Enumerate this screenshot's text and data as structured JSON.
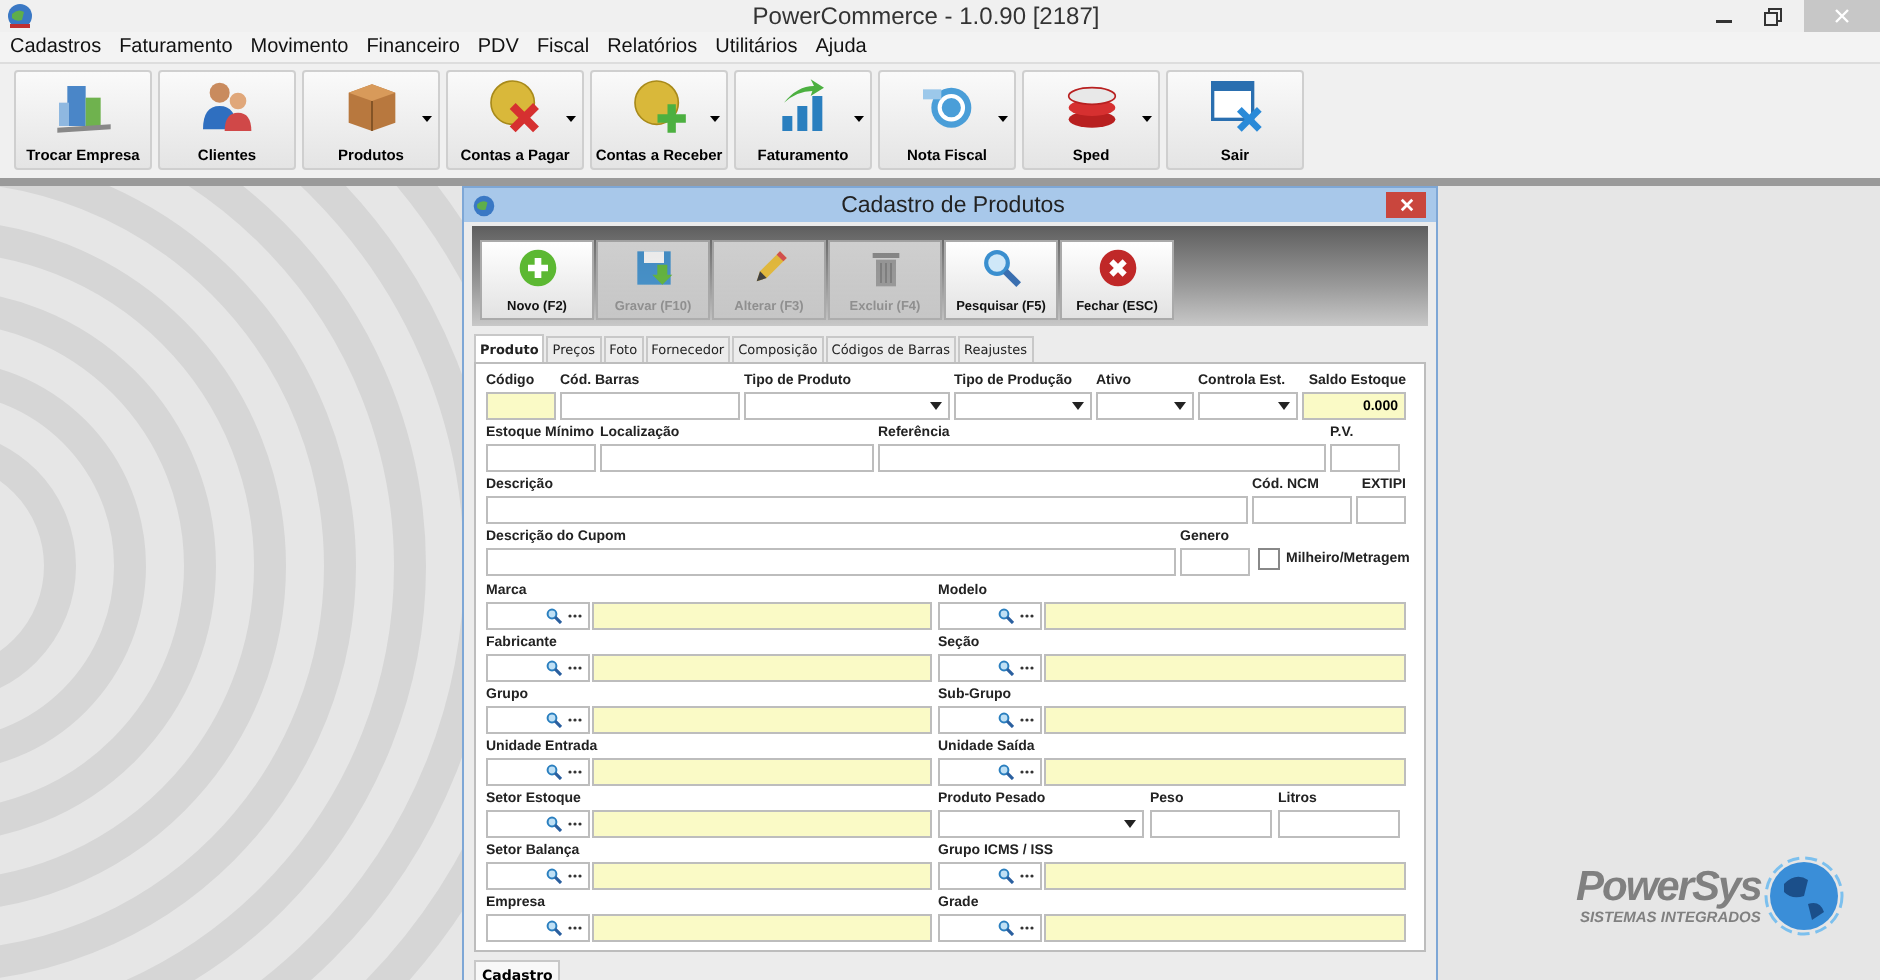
{
  "window": {
    "title": "PowerCommerce - 1.0.90 [2187]"
  },
  "menu": [
    "Cadastros",
    "Faturamento",
    "Movimento",
    "Financeiro",
    "PDV",
    "Fiscal",
    "Relatórios",
    "Utilitários",
    "Ajuda"
  ],
  "toolbar": [
    {
      "label": "Trocar Empresa",
      "dropdown": false
    },
    {
      "label": "Clientes",
      "dropdown": false
    },
    {
      "label": "Produtos",
      "dropdown": true
    },
    {
      "label": "Contas a Pagar",
      "dropdown": true
    },
    {
      "label": "Contas a Receber",
      "dropdown": true
    },
    {
      "label": "Faturamento",
      "dropdown": true
    },
    {
      "label": "Nota Fiscal",
      "dropdown": true
    },
    {
      "label": "Sped",
      "dropdown": true
    },
    {
      "label": "Sair",
      "dropdown": false
    }
  ],
  "dialog": {
    "title": "Cadastro de Produtos",
    "buttons": [
      {
        "label": "Novo (F2)",
        "disabled": false
      },
      {
        "label": "Gravar (F10)",
        "disabled": true
      },
      {
        "label": "Alterar (F3)",
        "disabled": true
      },
      {
        "label": "Excluir (F4)",
        "disabled": true
      },
      {
        "label": "Pesquisar (F5)",
        "disabled": false
      },
      {
        "label": "Fechar (ESC)",
        "disabled": false
      }
    ],
    "tabs": [
      {
        "label": "Produto",
        "selected": true
      },
      {
        "label": "Preços",
        "selected": false
      },
      {
        "label": "Foto",
        "selected": false
      },
      {
        "label": "Fornecedor",
        "selected": false
      },
      {
        "label": "Composição",
        "selected": false
      },
      {
        "label": "Códigos de Barras",
        "selected": false
      },
      {
        "label": "Reajustes",
        "selected": false
      }
    ],
    "top_rows": [
      [
        {
          "label": "Código",
          "kind": "text",
          "highlighted": true
        },
        {
          "label": "Cód. Barras",
          "kind": "text",
          "highlighted": false
        },
        {
          "label": "Tipo de Produto",
          "kind": "select"
        },
        {
          "label": "Tipo de Produção",
          "kind": "select"
        },
        {
          "label": "Ativo",
          "kind": "select"
        },
        {
          "label": "Controla Est.",
          "kind": "select"
        },
        {
          "label": "Saldo Estoque",
          "kind": "text",
          "highlighted": true,
          "value": "0.000"
        }
      ],
      [
        {
          "label": "Estoque Mínimo",
          "kind": "text",
          "highlighted": false
        },
        {
          "label": "Localização",
          "kind": "text",
          "highlighted": false
        },
        {
          "label": "Referência",
          "kind": "text",
          "highlighted": false
        },
        {
          "label": "P.V.",
          "kind": "text",
          "highlighted": false
        }
      ],
      [
        {
          "label": "Descrição",
          "kind": "text",
          "highlighted": false
        },
        {
          "label": "Cód. NCM",
          "kind": "text",
          "highlighted": false
        },
        {
          "label": "EXTIPI",
          "kind": "text",
          "highlighted": false
        }
      ],
      [
        {
          "label": "Descrição do Cupom",
          "kind": "text",
          "highlighted": false
        },
        {
          "label": "Genero",
          "kind": "text",
          "highlighted": false
        },
        {
          "label": "Milheiro/Metragem",
          "kind": "checkbox",
          "checked": false
        }
      ]
    ],
    "lower_rows": [
      [
        [
          {
            "label": "Marca",
            "kind": "lookup"
          }
        ],
        [
          {
            "label": "Modelo",
            "kind": "lookup"
          }
        ]
      ],
      [
        [
          {
            "label": "Fabricante",
            "kind": "lookup"
          }
        ],
        [
          {
            "label": "Seção",
            "kind": "lookup"
          }
        ]
      ],
      [
        [
          {
            "label": "Grupo",
            "kind": "lookup"
          }
        ],
        [
          {
            "label": "Sub-Grupo",
            "kind": "lookup"
          }
        ]
      ],
      [
        [
          {
            "label": "Unidade Entrada",
            "kind": "lookup"
          }
        ],
        [
          {
            "label": "Unidade Saída",
            "kind": "lookup"
          }
        ]
      ],
      [
        [
          {
            "label": "Setor Estoque",
            "kind": "lookup"
          }
        ],
        [
          {
            "label": "Produto Pesado",
            "kind": "select"
          },
          {
            "label": "Peso",
            "kind": "text"
          },
          {
            "label": "Litros",
            "kind": "text"
          }
        ]
      ],
      [
        [
          {
            "label": "Setor Balança",
            "kind": "lookup"
          }
        ],
        [
          {
            "label": "Grupo ICMS / ISS",
            "kind": "lookup"
          }
        ]
      ],
      [
        [
          {
            "label": "Empresa",
            "kind": "lookup"
          }
        ],
        [
          {
            "label": "Grade",
            "kind": "lookup"
          }
        ]
      ]
    ],
    "bottom_tabs": [
      {
        "label": "Cadastro",
        "selected": true
      }
    ]
  },
  "logo": {
    "name": "PowerSys",
    "tagline": "SISTEMAS INTEGRADOS"
  }
}
